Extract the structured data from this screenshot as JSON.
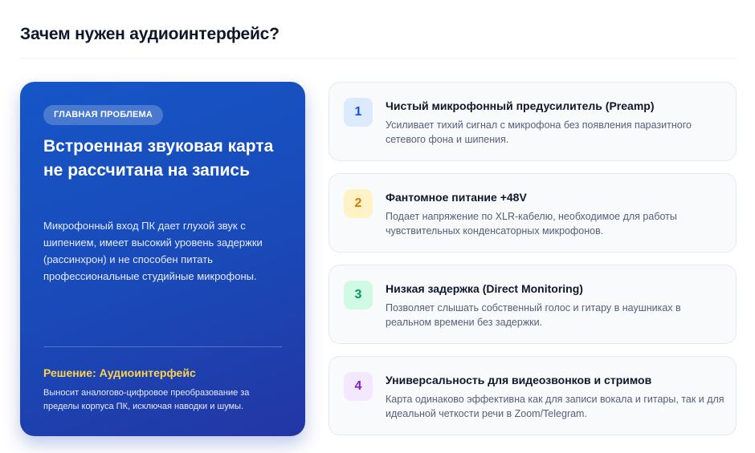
{
  "page": {
    "title": "Зачем нужен аудиоинтерфейс?"
  },
  "problem_card": {
    "badge": "ГЛАВНАЯ ПРОБЛЕМА",
    "heading": "Встроенная звуковая карта не рассчитана на запись",
    "text": "Микрофонный вход ПК дает глухой звук с шипением, имеет высокий уровень задержки (рассинхрон) и не способен питать профессиональные студийные микрофоны.",
    "solution_title": "Решение: Аудиоинтерфейс",
    "solution_text": "Выносит аналогово-цифровое преобразование за пределы корпуса ПК, исключая наводки и шумы.",
    "gradient_colors": [
      "#1656c7",
      "#2336a4"
    ],
    "accent_color": "#fcd34d"
  },
  "features": [
    {
      "number": "1",
      "title": "Чистый микрофонный предусилитель (Preamp)",
      "description": "Усиливает тихий сигнал с микрофона без появления паразитного сетевого фона и шипения.",
      "badge_bg": "#dbeafe",
      "badge_color": "#1d4ed8"
    },
    {
      "number": "2",
      "title": "Фантомное питание +48V",
      "description": "Подает напряжение по XLR-кабелю, необходимое для работы чувствительных конденсаторных микрофонов.",
      "badge_bg": "#fef3c7",
      "badge_color": "#d97706"
    },
    {
      "number": "3",
      "title": "Низкая задержка (Direct Monitoring)",
      "description": "Позволяет слышать собственный голос и гитару в наушниках в реальном времени без задержки.",
      "badge_bg": "#d1fae5",
      "badge_color": "#059669"
    },
    {
      "number": "4",
      "title": "Универсальность для видеозвонков и стримов",
      "description": "Карта одинаково эффективна как для записи вокала и гитары, так и для идеальной четкости речи в Zoom/Telegram.",
      "badge_bg": "#f3e8ff",
      "badge_color": "#7e22ce"
    }
  ]
}
